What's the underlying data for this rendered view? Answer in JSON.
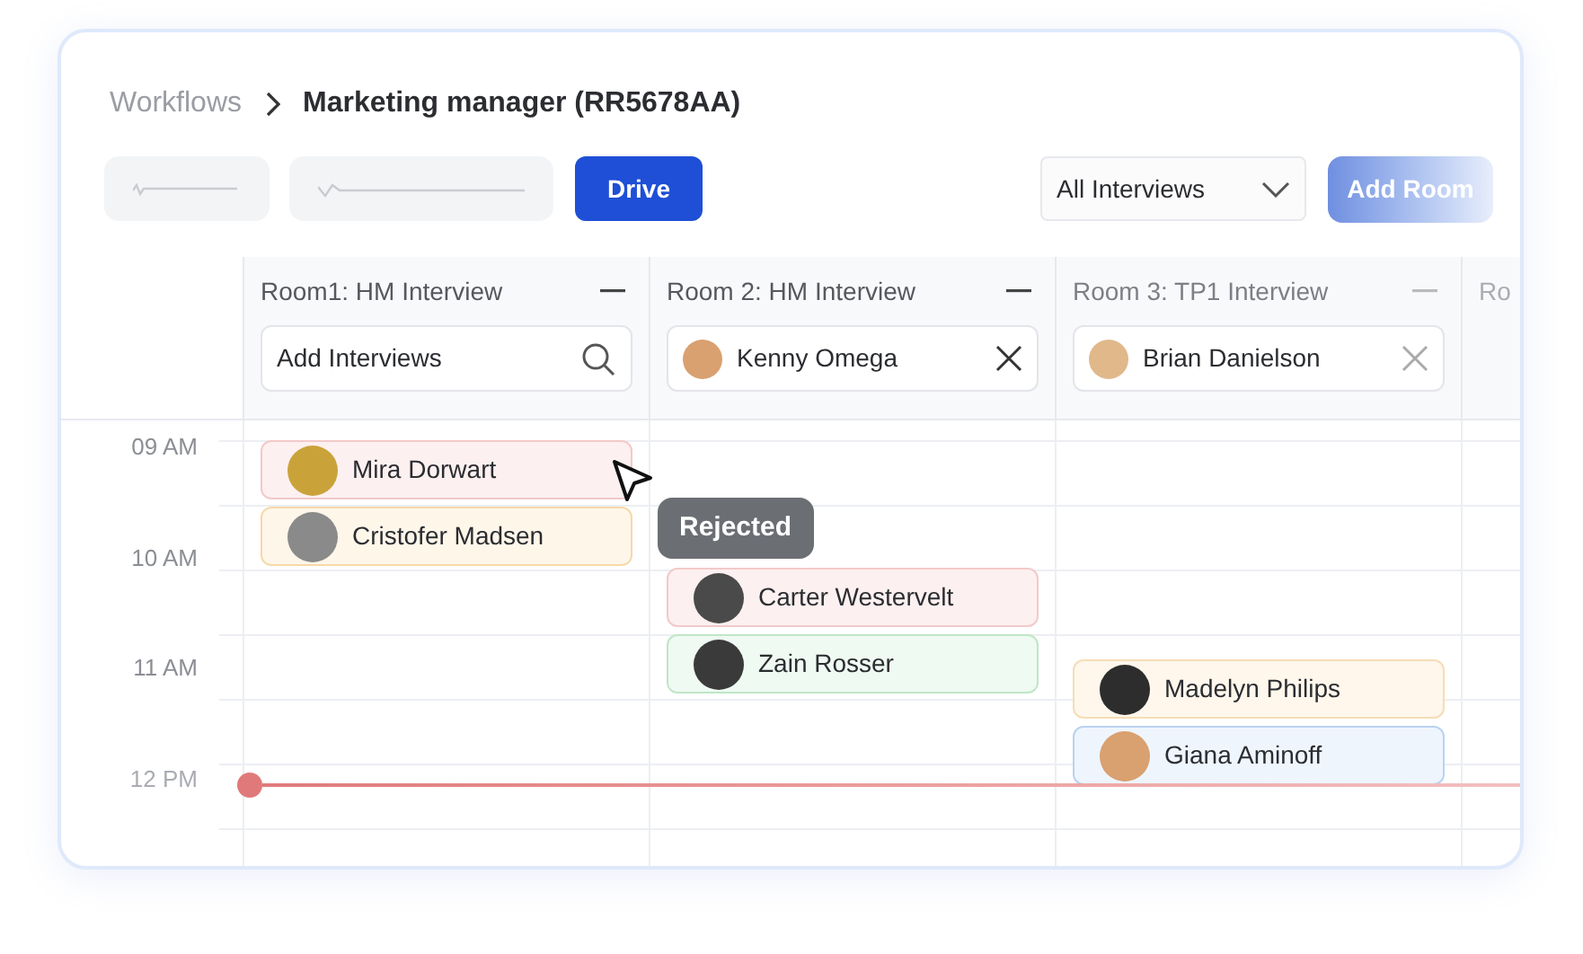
{
  "breadcrumb": {
    "parent": "Workflows",
    "current": "Marketing manager (RR5678AA)"
  },
  "toolbar": {
    "primary_button": "Drive",
    "filter": {
      "value": "All Interviews"
    },
    "add_button": "Add Room"
  },
  "time_labels": [
    "09 AM",
    "10 AM",
    "11 AM",
    "12 PM"
  ],
  "rooms": [
    {
      "title": "Room1: HM Interview",
      "field": {
        "kind": "search",
        "placeholder": "Add Interviews"
      },
      "events": [
        {
          "name": "Mira Dorwart",
          "color": "#f3c9c9"
        },
        {
          "name": "Cristofer Madsen",
          "color": "#f5d9aa"
        }
      ]
    },
    {
      "title": "Room 2: HM Interview",
      "field": {
        "kind": "person",
        "value": "Kenny Omega"
      },
      "events": [
        {
          "name": "Carter Westervelt",
          "color": "#f3c9c9"
        },
        {
          "name": "Zain Rosser",
          "color": "#bfe6c8"
        }
      ]
    },
    {
      "title": "Room 3: TP1 Interview",
      "field": {
        "kind": "person",
        "value": "Brian Danielson"
      },
      "events": [
        {
          "name": "Madelyn Philips",
          "color": "#f5ddb5"
        },
        {
          "name": "Giana Aminoff",
          "color": "#b9d2f0"
        }
      ]
    },
    {
      "title": "Ro"
    }
  ],
  "tooltip": "Rejected"
}
